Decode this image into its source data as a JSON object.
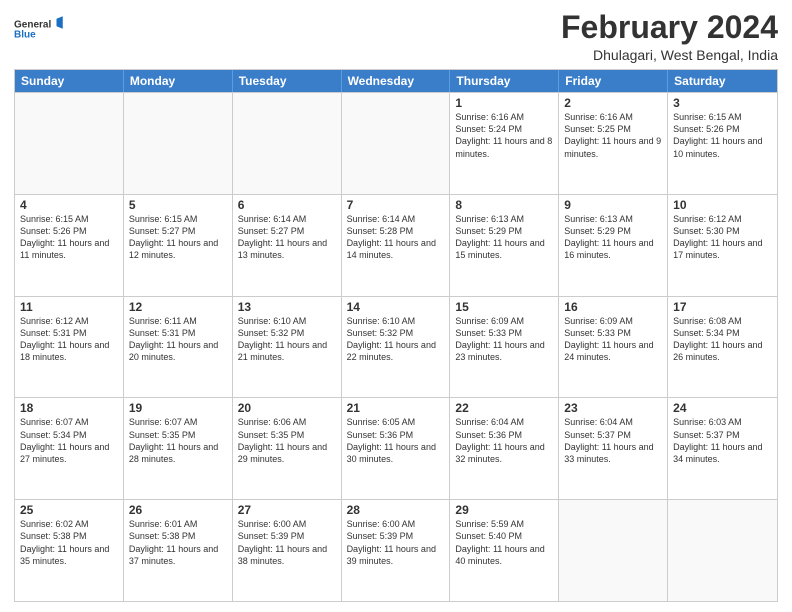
{
  "logo": {
    "line1": "General",
    "line2": "Blue"
  },
  "title": "February 2024",
  "location": "Dhulagari, West Bengal, India",
  "days_of_week": [
    "Sunday",
    "Monday",
    "Tuesday",
    "Wednesday",
    "Thursday",
    "Friday",
    "Saturday"
  ],
  "weeks": [
    [
      {
        "day": "",
        "info": ""
      },
      {
        "day": "",
        "info": ""
      },
      {
        "day": "",
        "info": ""
      },
      {
        "day": "",
        "info": ""
      },
      {
        "day": "1",
        "info": "Sunrise: 6:16 AM\nSunset: 5:24 PM\nDaylight: 11 hours and 8 minutes."
      },
      {
        "day": "2",
        "info": "Sunrise: 6:16 AM\nSunset: 5:25 PM\nDaylight: 11 hours and 9 minutes."
      },
      {
        "day": "3",
        "info": "Sunrise: 6:15 AM\nSunset: 5:26 PM\nDaylight: 11 hours and 10 minutes."
      }
    ],
    [
      {
        "day": "4",
        "info": "Sunrise: 6:15 AM\nSunset: 5:26 PM\nDaylight: 11 hours and 11 minutes."
      },
      {
        "day": "5",
        "info": "Sunrise: 6:15 AM\nSunset: 5:27 PM\nDaylight: 11 hours and 12 minutes."
      },
      {
        "day": "6",
        "info": "Sunrise: 6:14 AM\nSunset: 5:27 PM\nDaylight: 11 hours and 13 minutes."
      },
      {
        "day": "7",
        "info": "Sunrise: 6:14 AM\nSunset: 5:28 PM\nDaylight: 11 hours and 14 minutes."
      },
      {
        "day": "8",
        "info": "Sunrise: 6:13 AM\nSunset: 5:29 PM\nDaylight: 11 hours and 15 minutes."
      },
      {
        "day": "9",
        "info": "Sunrise: 6:13 AM\nSunset: 5:29 PM\nDaylight: 11 hours and 16 minutes."
      },
      {
        "day": "10",
        "info": "Sunrise: 6:12 AM\nSunset: 5:30 PM\nDaylight: 11 hours and 17 minutes."
      }
    ],
    [
      {
        "day": "11",
        "info": "Sunrise: 6:12 AM\nSunset: 5:31 PM\nDaylight: 11 hours and 18 minutes."
      },
      {
        "day": "12",
        "info": "Sunrise: 6:11 AM\nSunset: 5:31 PM\nDaylight: 11 hours and 20 minutes."
      },
      {
        "day": "13",
        "info": "Sunrise: 6:10 AM\nSunset: 5:32 PM\nDaylight: 11 hours and 21 minutes."
      },
      {
        "day": "14",
        "info": "Sunrise: 6:10 AM\nSunset: 5:32 PM\nDaylight: 11 hours and 22 minutes."
      },
      {
        "day": "15",
        "info": "Sunrise: 6:09 AM\nSunset: 5:33 PM\nDaylight: 11 hours and 23 minutes."
      },
      {
        "day": "16",
        "info": "Sunrise: 6:09 AM\nSunset: 5:33 PM\nDaylight: 11 hours and 24 minutes."
      },
      {
        "day": "17",
        "info": "Sunrise: 6:08 AM\nSunset: 5:34 PM\nDaylight: 11 hours and 26 minutes."
      }
    ],
    [
      {
        "day": "18",
        "info": "Sunrise: 6:07 AM\nSunset: 5:34 PM\nDaylight: 11 hours and 27 minutes."
      },
      {
        "day": "19",
        "info": "Sunrise: 6:07 AM\nSunset: 5:35 PM\nDaylight: 11 hours and 28 minutes."
      },
      {
        "day": "20",
        "info": "Sunrise: 6:06 AM\nSunset: 5:35 PM\nDaylight: 11 hours and 29 minutes."
      },
      {
        "day": "21",
        "info": "Sunrise: 6:05 AM\nSunset: 5:36 PM\nDaylight: 11 hours and 30 minutes."
      },
      {
        "day": "22",
        "info": "Sunrise: 6:04 AM\nSunset: 5:36 PM\nDaylight: 11 hours and 32 minutes."
      },
      {
        "day": "23",
        "info": "Sunrise: 6:04 AM\nSunset: 5:37 PM\nDaylight: 11 hours and 33 minutes."
      },
      {
        "day": "24",
        "info": "Sunrise: 6:03 AM\nSunset: 5:37 PM\nDaylight: 11 hours and 34 minutes."
      }
    ],
    [
      {
        "day": "25",
        "info": "Sunrise: 6:02 AM\nSunset: 5:38 PM\nDaylight: 11 hours and 35 minutes."
      },
      {
        "day": "26",
        "info": "Sunrise: 6:01 AM\nSunset: 5:38 PM\nDaylight: 11 hours and 37 minutes."
      },
      {
        "day": "27",
        "info": "Sunrise: 6:00 AM\nSunset: 5:39 PM\nDaylight: 11 hours and 38 minutes."
      },
      {
        "day": "28",
        "info": "Sunrise: 6:00 AM\nSunset: 5:39 PM\nDaylight: 11 hours and 39 minutes."
      },
      {
        "day": "29",
        "info": "Sunrise: 5:59 AM\nSunset: 5:40 PM\nDaylight: 11 hours and 40 minutes."
      },
      {
        "day": "",
        "info": ""
      },
      {
        "day": "",
        "info": ""
      }
    ]
  ]
}
